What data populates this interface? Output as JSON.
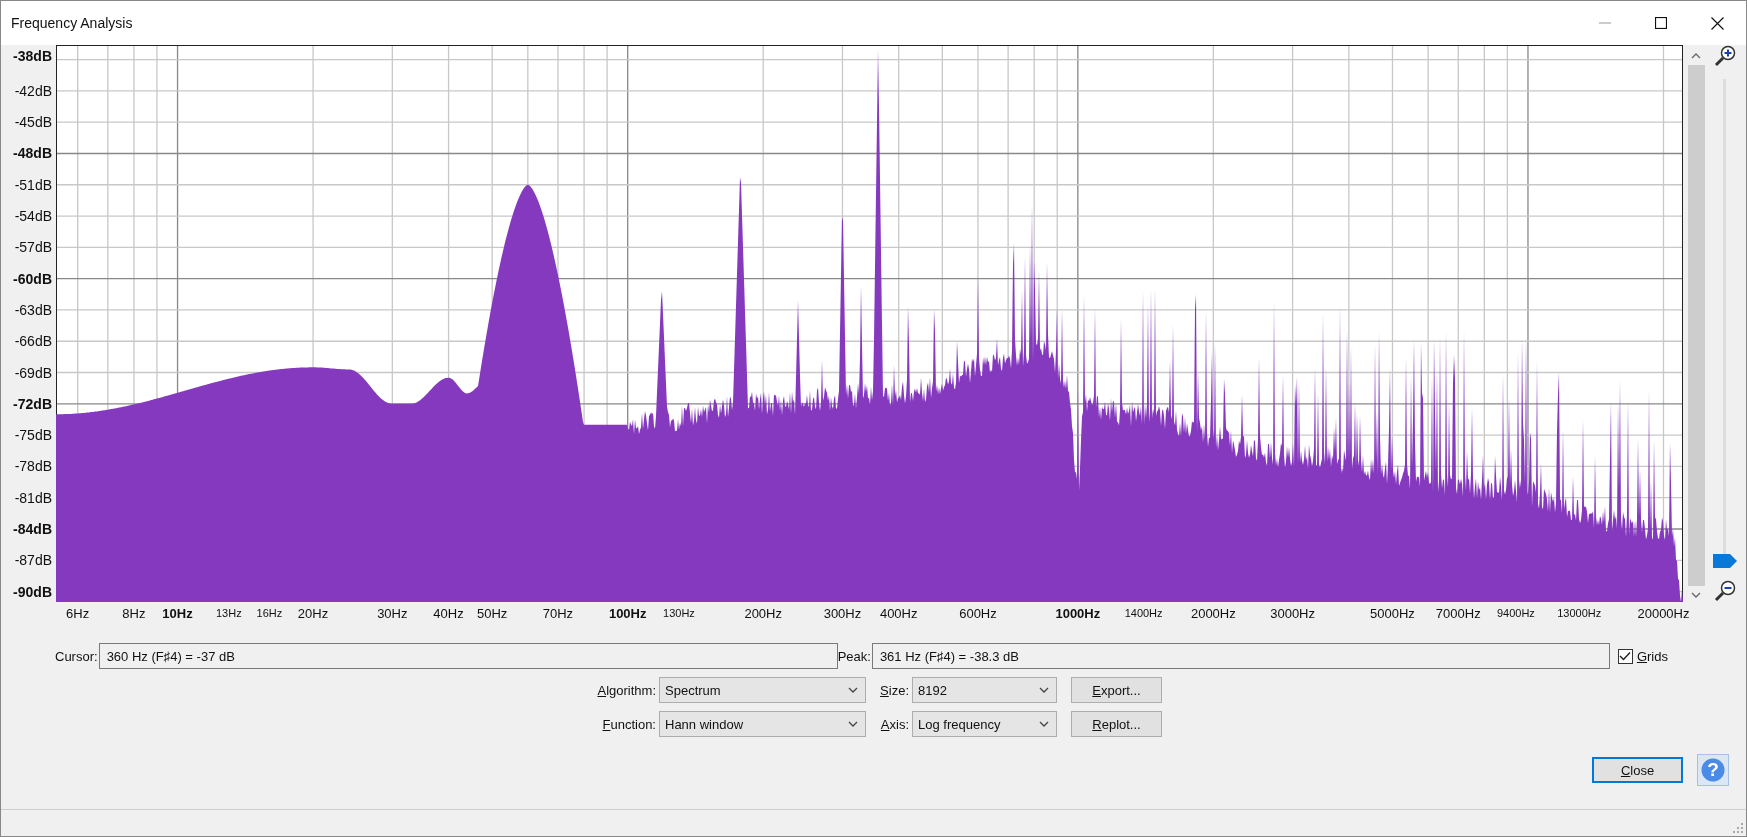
{
  "window": {
    "title": "Frequency Analysis"
  },
  "plot": {
    "y_axis_labels": [
      {
        "text": "-38dB",
        "major": true
      },
      {
        "text": "-42dB",
        "major": false
      },
      {
        "text": "-45dB",
        "major": false
      },
      {
        "text": "-48dB",
        "major": true
      },
      {
        "text": "-51dB",
        "major": false
      },
      {
        "text": "-54dB",
        "major": false
      },
      {
        "text": "-57dB",
        "major": false
      },
      {
        "text": "-60dB",
        "major": true
      },
      {
        "text": "-63dB",
        "major": false
      },
      {
        "text": "-66dB",
        "major": false
      },
      {
        "text": "-69dB",
        "major": false
      },
      {
        "text": "-72dB",
        "major": true
      },
      {
        "text": "-75dB",
        "major": false
      },
      {
        "text": "-78dB",
        "major": false
      },
      {
        "text": "-81dB",
        "major": false
      },
      {
        "text": "-84dB",
        "major": true
      },
      {
        "text": "-87dB",
        "major": false
      },
      {
        "text": "-90dB",
        "major": true
      }
    ],
    "x_axis_labels": [
      {
        "text": "6Hz",
        "kind": "normal"
      },
      {
        "text": "8Hz",
        "kind": "normal"
      },
      {
        "text": "10Hz",
        "kind": "major"
      },
      {
        "text": "13Hz",
        "kind": "small"
      },
      {
        "text": "16Hz",
        "kind": "small"
      },
      {
        "text": "20Hz",
        "kind": "normal"
      },
      {
        "text": "30Hz",
        "kind": "normal"
      },
      {
        "text": "40Hz",
        "kind": "normal"
      },
      {
        "text": "50Hz",
        "kind": "normal"
      },
      {
        "text": "70Hz",
        "kind": "normal"
      },
      {
        "text": "100Hz",
        "kind": "major"
      },
      {
        "text": "130Hz",
        "kind": "small"
      },
      {
        "text": "200Hz",
        "kind": "normal"
      },
      {
        "text": "300Hz",
        "kind": "normal"
      },
      {
        "text": "400Hz",
        "kind": "normal"
      },
      {
        "text": "600Hz",
        "kind": "normal"
      },
      {
        "text": "1000Hz",
        "kind": "major"
      },
      {
        "text": "1400Hz",
        "kind": "small"
      },
      {
        "text": "2000Hz",
        "kind": "normal"
      },
      {
        "text": "3000Hz",
        "kind": "normal"
      },
      {
        "text": "5000Hz",
        "kind": "normal"
      },
      {
        "text": "7000Hz",
        "kind": "normal"
      },
      {
        "text": "9400Hz",
        "kind": "small"
      },
      {
        "text": "13000Hz",
        "kind": "small"
      },
      {
        "text": "20000Hz",
        "kind": "normal"
      }
    ]
  },
  "zoom": {
    "level": 0
  },
  "cursor": {
    "label": "Cursor:",
    "value": "360 Hz (F♯4) = -37 dB"
  },
  "peak": {
    "label": "Peak:",
    "value": "361 Hz (F♯4) = -38.3 dB"
  },
  "grids": {
    "label": "Grids",
    "checked": true
  },
  "algorithm": {
    "label": "Algorithm:",
    "value": "Spectrum"
  },
  "size": {
    "label": "Size:",
    "value": "8192"
  },
  "function": {
    "label": "Function:",
    "value": "Hann window"
  },
  "axis": {
    "label": "Axis:",
    "value": "Log frequency"
  },
  "buttons": {
    "export": "Export...",
    "replot": "Replot...",
    "close": "Close",
    "help": "?"
  }
}
